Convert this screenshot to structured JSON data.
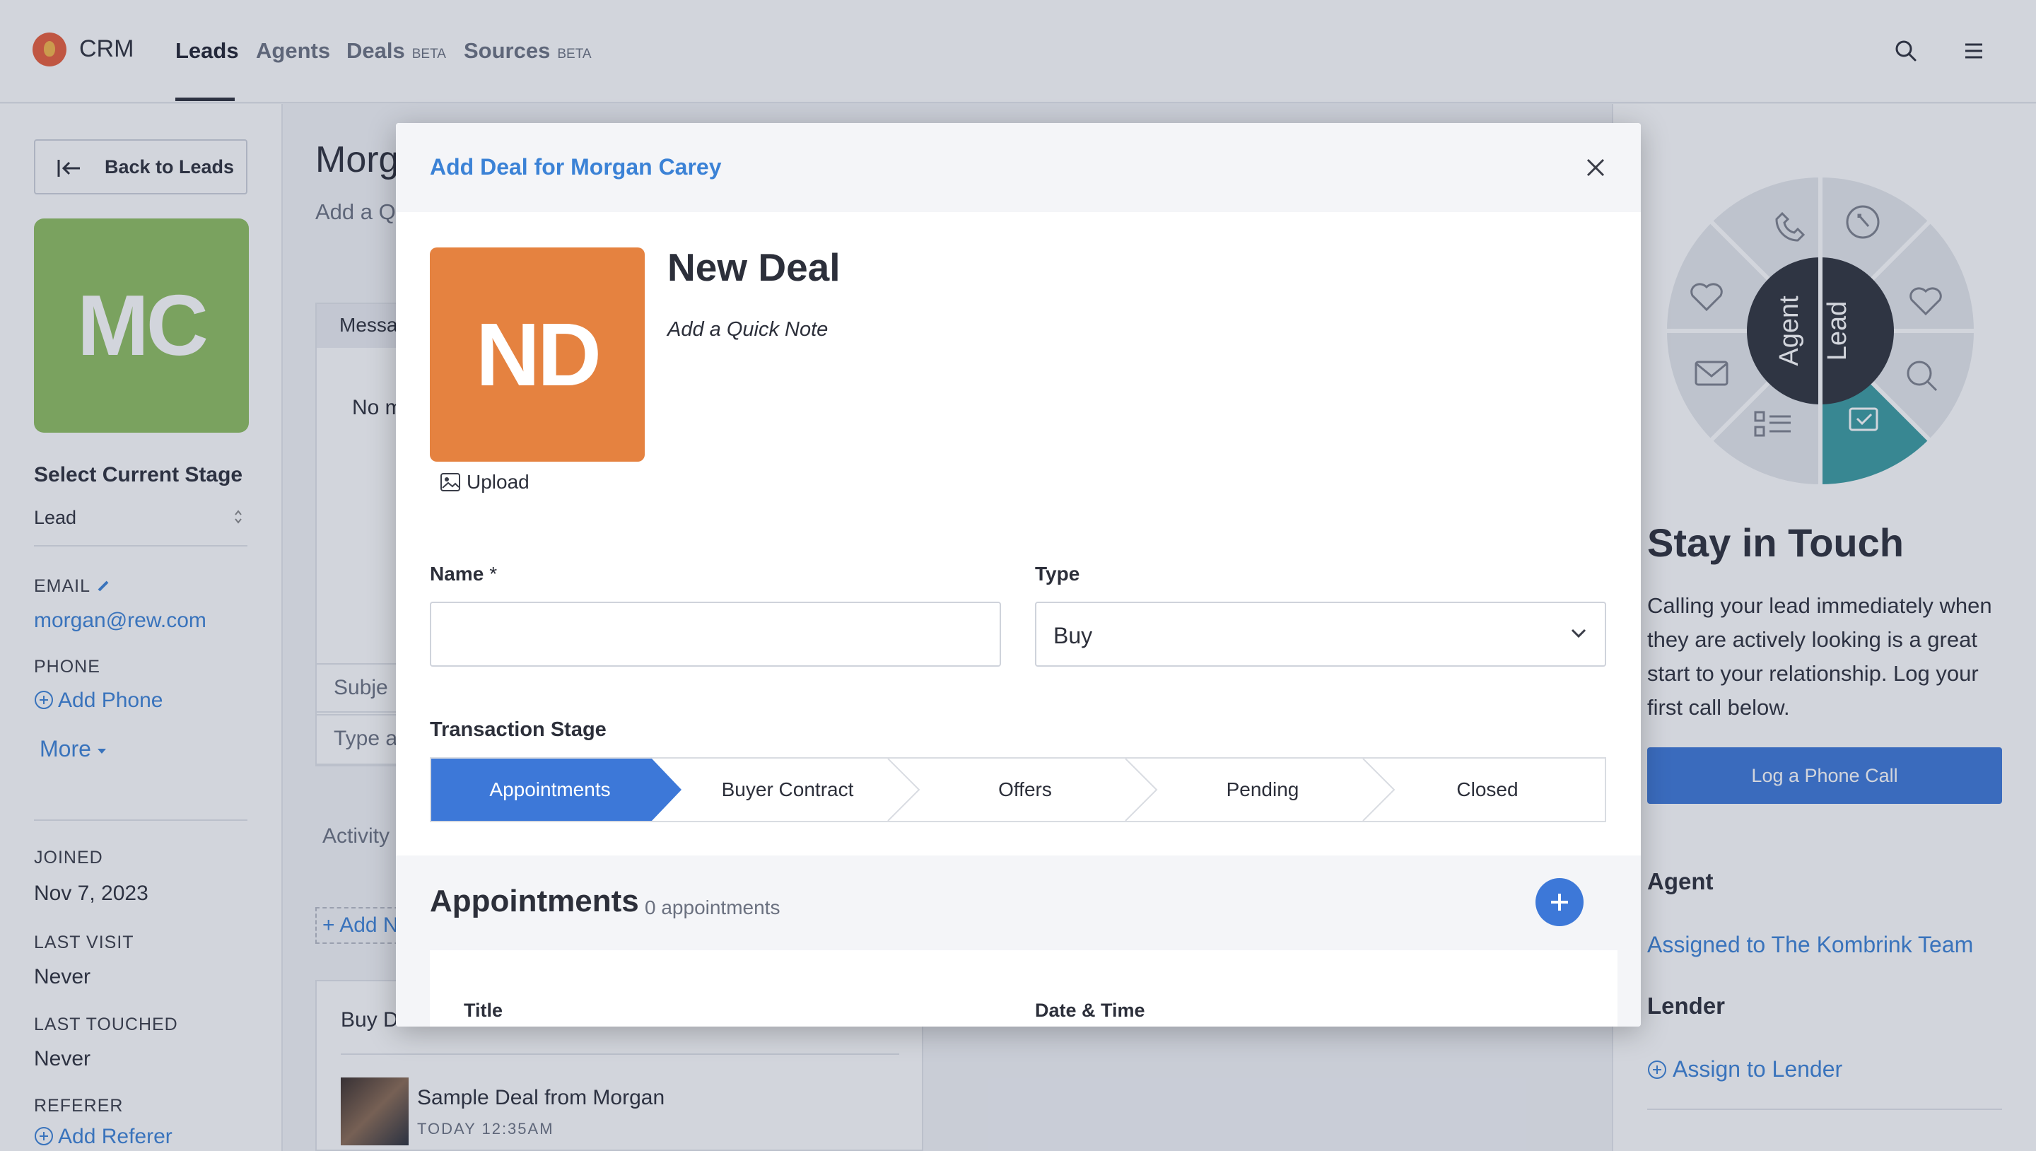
{
  "topnav": {
    "brand": "CRM",
    "tabs": [
      {
        "label": "Leads",
        "beta": ""
      },
      {
        "label": "Agents",
        "beta": ""
      },
      {
        "label": "Deals",
        "beta": "BETA"
      },
      {
        "label": "Sources",
        "beta": "BETA"
      }
    ]
  },
  "sidebar": {
    "back_label": "Back to Leads",
    "initials": "MC",
    "stage_heading": "Select Current Stage",
    "stage_value": "Lead",
    "email_label": "EMAIL",
    "email_value": "morgan@rew.com",
    "phone_label": "PHONE",
    "add_phone": "Add Phone",
    "more": "More",
    "joined_label": "JOINED",
    "joined_value": "Nov 7, 2023",
    "last_visit_label": "LAST VISIT",
    "last_visit_value": "Never",
    "last_touched_label": "LAST TOUCHED",
    "last_touched_value": "Never",
    "referer_label": "REFERER",
    "add_referer": "Add Referer"
  },
  "background": {
    "title": "Morg",
    "subtitle": "Add a Q",
    "message_tab": "Messa",
    "no_messages": "No m",
    "subject": "Subje",
    "type_placeholder": "Type a",
    "activity": "Activity",
    "add_note": "+ Add N",
    "buy_deal": "Buy D",
    "deal_title": "Sample Deal from Morgan",
    "deal_time": "TODAY  12:35AM"
  },
  "right_panel": {
    "wheel_agent": "Agent",
    "wheel_lead": "Lead",
    "stay_title": "Stay in Touch",
    "stay_body": "Calling your lead immediately when they are actively looking is a great start to your relationship. Log your first call below.",
    "log_button": "Log a Phone Call",
    "agent_heading": "Agent",
    "agent_link": "Assigned to The Kombrink Team",
    "lender_heading": "Lender",
    "lender_link": "Assign to Lender"
  },
  "modal": {
    "title": "Add Deal for Morgan Carey",
    "initials": "ND",
    "upload": "Upload",
    "deal_name": "New Deal",
    "quick_note": "Add a Quick Note",
    "name_label": "Name",
    "name_required": "*",
    "name_value": "",
    "type_label": "Type",
    "type_value": "Buy",
    "transaction_label": "Transaction Stage",
    "stages": [
      "Appointments",
      "Buyer Contract",
      "Offers",
      "Pending",
      "Closed"
    ],
    "active_stage": "Appointments",
    "appointments_title": "Appointments",
    "appointments_count": "0 appointments",
    "col_title": "Title",
    "col_datetime": "Date & Time"
  },
  "colors": {
    "accent_blue": "#3d78d8",
    "link_blue": "#3b82d6",
    "avatar_green": "#8fbe5f",
    "avatar_orange": "#e58240",
    "wheel_dark": "#2f323c",
    "wheel_teal": "#3a9ca0"
  },
  "icons": [
    "back-arrow-icon",
    "search-icon",
    "menu-icon",
    "edit-pencil-icon",
    "plus-circle-icon",
    "caret-down-icon",
    "close-icon",
    "image-icon",
    "chevron-down-icon",
    "plus-icon"
  ]
}
